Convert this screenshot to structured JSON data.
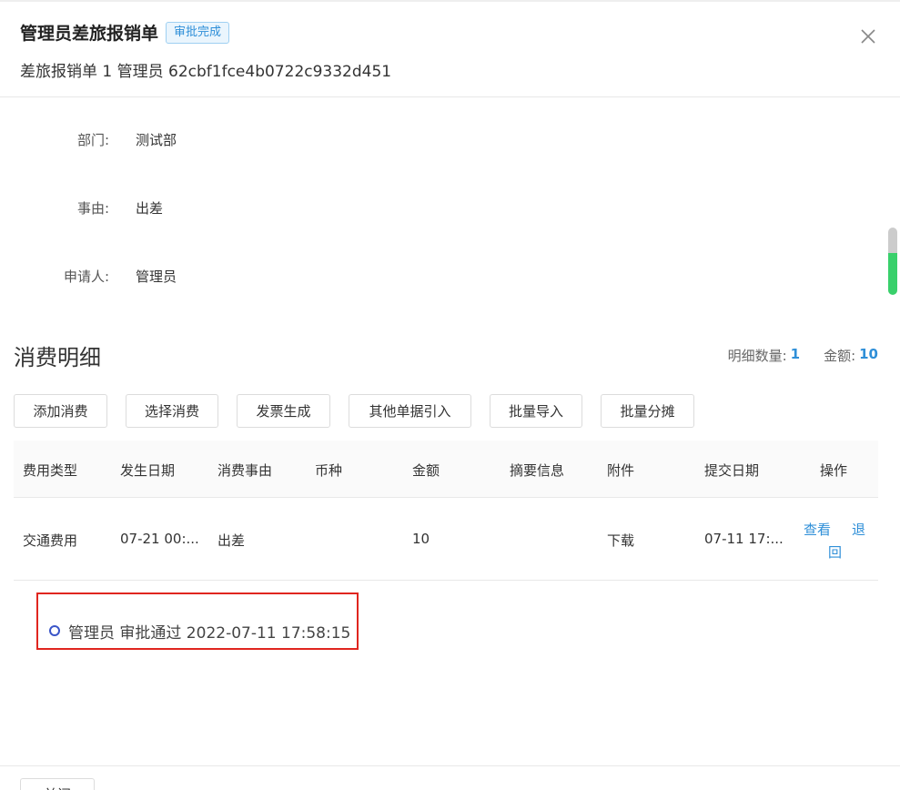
{
  "header": {
    "title": "管理员差旅报销单",
    "status_badge": "审批完成",
    "subtitle": "差旅报销单 1 管理员 62cbf1fce4b0722c9332d451"
  },
  "fields": [
    {
      "label": "部门:",
      "value": "测试部"
    },
    {
      "label": "事由:",
      "value": "出差"
    },
    {
      "label": "申请人:",
      "value": "管理员"
    }
  ],
  "section": {
    "title": "消费明细",
    "count_label": "明细数量:",
    "count_value": "1",
    "amount_label": "金额:",
    "amount_value": "10"
  },
  "actions": [
    "添加消费",
    "选择消费",
    "发票生成",
    "其他单据引入",
    "批量导入",
    "批量分摊"
  ],
  "table": {
    "columns": [
      "费用类型",
      "发生日期",
      "消费事由",
      "币种",
      "金额",
      "摘要信息",
      "附件",
      "提交日期",
      "操作"
    ],
    "rows": [
      {
        "type": "交通费用",
        "date": "07-21 00:...",
        "reason": "出差",
        "currency": "",
        "amount": "10",
        "summary": "",
        "attachment": "下载",
        "submit_date": "07-11 17:...",
        "op_view": "查看",
        "op_return_1": "退",
        "op_return_2": "回"
      }
    ]
  },
  "timeline": {
    "entry": "管理员 审批通过 2022-07-11 17:58:15"
  },
  "footer": {
    "button_label": "关闭"
  }
}
